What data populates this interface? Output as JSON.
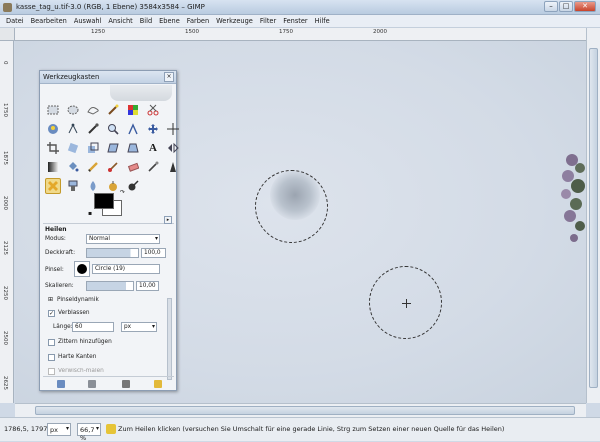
{
  "window": {
    "title": "kasse_tag_u.tif-3.0 (RGB, 1 Ebene) 3584x3584 – GIMP"
  },
  "menu": [
    "Datei",
    "Bearbeiten",
    "Auswahl",
    "Ansicht",
    "Bild",
    "Ebene",
    "Farben",
    "Werkzeuge",
    "Filter",
    "Fenster",
    "Hilfe"
  ],
  "ruler": {
    "h": [
      "1250",
      "1500",
      "1750",
      "2000"
    ],
    "v": [
      "0",
      "1750",
      "1875",
      "2000",
      "2125",
      "2250",
      "2500",
      "2625"
    ]
  },
  "toolbox": {
    "title": "Werkzeugkasten",
    "options": {
      "title": "Heilen",
      "mode_label": "Modus:",
      "mode_value": "Normal",
      "opacity_label": "Deckkraft:",
      "opacity_value": "100,0",
      "brush_label": "Pinsel:",
      "brush_value": "Circle (19)",
      "scale_label": "Skalieren:",
      "scale_value": "10,00",
      "dynamics_label": "Pinseldynamik",
      "fade_label": "Verblassen",
      "length_label": "Länge:",
      "length_value": "60",
      "length_unit": "px",
      "jitter_label": "Zittern hinzufügen",
      "hard_label": "Harte Kanten",
      "incremental_label": "Verwisch-malen"
    }
  },
  "status": {
    "coords": "1786,5, 1797,0",
    "unit": "px",
    "zoom": "66,7 %",
    "message": "Zum Heilen klicken (versuchen Sie Umschalt für eine gerade Linie, Strg zum Setzen einer neuen Quelle für das Heilen)"
  },
  "colors": {
    "accent": "#f0d98a",
    "foreground": "#000000",
    "background": "#ffffff"
  }
}
